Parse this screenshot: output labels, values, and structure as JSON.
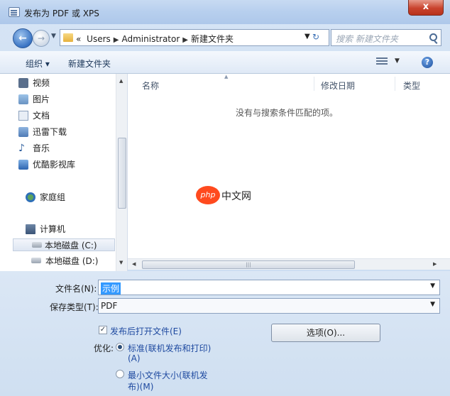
{
  "window": {
    "title": "发布为 PDF 或 XPS",
    "close_label": "x"
  },
  "navbar": {
    "breadcrumbs": [
      "Users",
      "Administrator",
      "新建文件夹"
    ],
    "breadcrumb_prefix": "«",
    "search_placeholder": "搜索 新建文件夹"
  },
  "toolbar": {
    "organize_label": "组织 ▾",
    "new_folder_label": "新建文件夹"
  },
  "sidebar": {
    "items": [
      {
        "label": "视频",
        "icon": "video-icon"
      },
      {
        "label": "图片",
        "icon": "pictures-icon"
      },
      {
        "label": "文档",
        "icon": "documents-icon"
      },
      {
        "label": "迅雷下载",
        "icon": "download-icon"
      },
      {
        "label": "音乐",
        "icon": "music-icon"
      },
      {
        "label": "优酷影视库",
        "icon": "library-icon"
      },
      {
        "label": "家庭组",
        "icon": "homegroup-icon"
      },
      {
        "label": "计算机",
        "icon": "computer-icon"
      },
      {
        "label": "本地磁盘 (C:)",
        "icon": "disk-icon"
      },
      {
        "label": "本地磁盘 (D:)",
        "icon": "disk-icon"
      }
    ],
    "selected_index": 8
  },
  "filelist": {
    "columns": [
      "名称",
      "修改日期",
      "类型"
    ],
    "empty_message": "没有与搜索条件匹配的项。"
  },
  "watermark": {
    "badge": "php",
    "text": "中文网"
  },
  "form": {
    "filename_label": "文件名(N):",
    "filename_value": "示例",
    "filetype_label": "保存类型(T):",
    "filetype_value": "PDF",
    "open_after_publish_label": "发布后打开文件(E)",
    "open_after_publish_checked": true,
    "optimize_label": "优化:",
    "option_standard_line1": "标准(联机发布和打印)",
    "option_standard_line2": "(A)",
    "option_minimum_line1": "最小文件大小(联机发",
    "option_minimum_line2": "布)(M)",
    "options_button": "选项(O)..."
  },
  "colors": {
    "accent": "#3399ff",
    "link_blue": "#1f4aa0",
    "close_red": "#c9432d",
    "watermark_orange": "#ff4a1e"
  }
}
